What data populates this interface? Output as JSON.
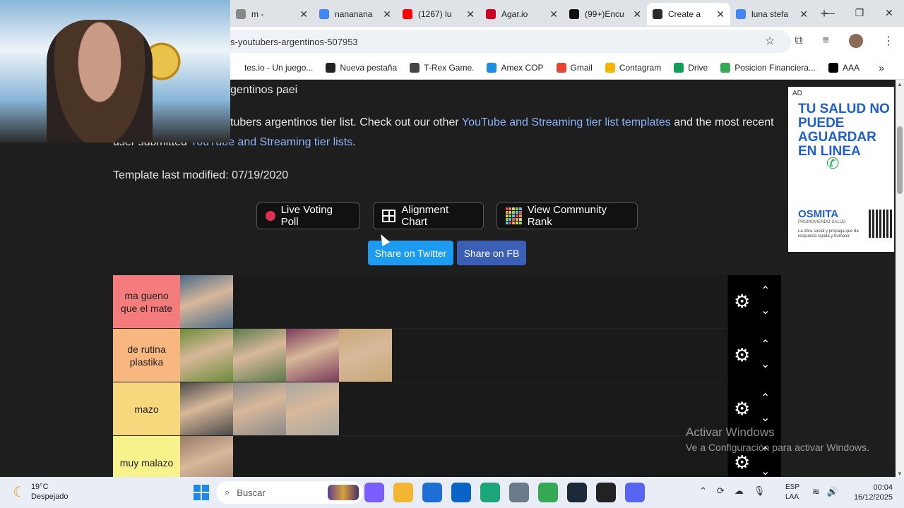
{
  "browser": {
    "tabs": [
      {
        "label": "m -",
        "color": "#888888",
        "active": false
      },
      {
        "label": "nananana",
        "color": "#4285f4",
        "active": false
      },
      {
        "label": "(1267) lu",
        "color": "#ff0000",
        "active": false
      },
      {
        "label": "Agar.io",
        "color": "#cc0022",
        "active": false
      },
      {
        "label": "(99+)Encu",
        "color": "#111111",
        "active": false
      },
      {
        "label": "Create a",
        "color": "#2b2b2b",
        "active": true
      },
      {
        "label": "luna stefa",
        "color": "#4285f4",
        "active": false
      }
    ],
    "new_tab": "+",
    "url": "s-youtubers-argentinos-507953",
    "bookmarks": [
      {
        "label": "tes.io - Un juego...",
        "color": "#ffffff"
      },
      {
        "label": "Nueva pestaña",
        "color": "#222222"
      },
      {
        "label": "T-Rex Game.",
        "color": "#444444"
      },
      {
        "label": "Amex COP",
        "color": "#1a8fe0"
      },
      {
        "label": "Gmail",
        "color": "#ea4335"
      },
      {
        "label": "Contagram",
        "color": "#f4b400"
      },
      {
        "label": "Drive",
        "color": "#0f9d58"
      },
      {
        "label": "Posicion Financiera...",
        "color": "#34a853"
      },
      {
        "label": "AAA",
        "color": "#000000"
      }
    ],
    "bookmarks_more": "»"
  },
  "page": {
    "line1": "gentinos paei",
    "line2_prefix": "tubers argentinos tier list. Check out our other ",
    "line2_link": "YouTube and Streaming tier list templates",
    "line2_suffix": " and the most recent",
    "line3_prefix": "user submitted ",
    "line3_link": "YouTube and Streaming tier lists",
    "line3_suffix": ".",
    "modified": "Template last modified: 07/19/2020",
    "buttons": {
      "live_poll": "Live Voting Poll",
      "alignment": "Alignment Chart",
      "community": "View Community Rank",
      "twitter": "Share on Twitter",
      "facebook": "Share on FB"
    },
    "tiers": [
      {
        "label": "ma gueno que el mate",
        "color": "#f47c7c",
        "item_colors": [
          "#4a6a8a"
        ]
      },
      {
        "label": "de rutina plastika",
        "color": "#f7b77f",
        "item_colors": [
          "#6b8c3a",
          "#5a7a4a",
          "#7a3a5a",
          "#c8a878"
        ]
      },
      {
        "label": "mazo",
        "color": "#f7d87c",
        "item_colors": [
          "#4a4a4a",
          "#8a8a8a",
          "#a8a8a0"
        ]
      },
      {
        "label": "muy malazo",
        "color": "#f7f28c",
        "item_colors": [
          "#9a7a6a"
        ]
      }
    ]
  },
  "ad": {
    "tag": "AD",
    "headline": "TU SALUD NO PUEDE AGUARDAR EN LINEA",
    "brand": "OSMITA",
    "brand_sub": "PROMOVIENDO SALUD",
    "small": "La obra social y prepaga que da respuesta rápida y humana"
  },
  "watermark": {
    "title": "Activar Windows",
    "subtitle": "Ve a Configuración para activar Windows."
  },
  "taskbar": {
    "temp": "19°C",
    "weather": "Despejado",
    "search": "Buscar",
    "lang1": "ESP",
    "lang2": "LAA",
    "time": "00:04",
    "date": "16/12/2025",
    "apps": [
      {
        "name": "copilot-icon",
        "color": "#7b5cff"
      },
      {
        "name": "file-explorer-icon",
        "color": "#f2b632"
      },
      {
        "name": "store-icon",
        "color": "#1e6ed6"
      },
      {
        "name": "outlook-icon",
        "color": "#0a64c8"
      },
      {
        "name": "edge-icon",
        "color": "#1aa57a"
      },
      {
        "name": "settings-icon",
        "color": "#6b7a8a"
      },
      {
        "name": "chrome-icon",
        "color": "#34a853"
      },
      {
        "name": "steam-icon",
        "color": "#1b2838"
      },
      {
        "name": "obs-icon",
        "color": "#222222"
      },
      {
        "name": "discord-icon",
        "color": "#5865f2"
      }
    ]
  }
}
